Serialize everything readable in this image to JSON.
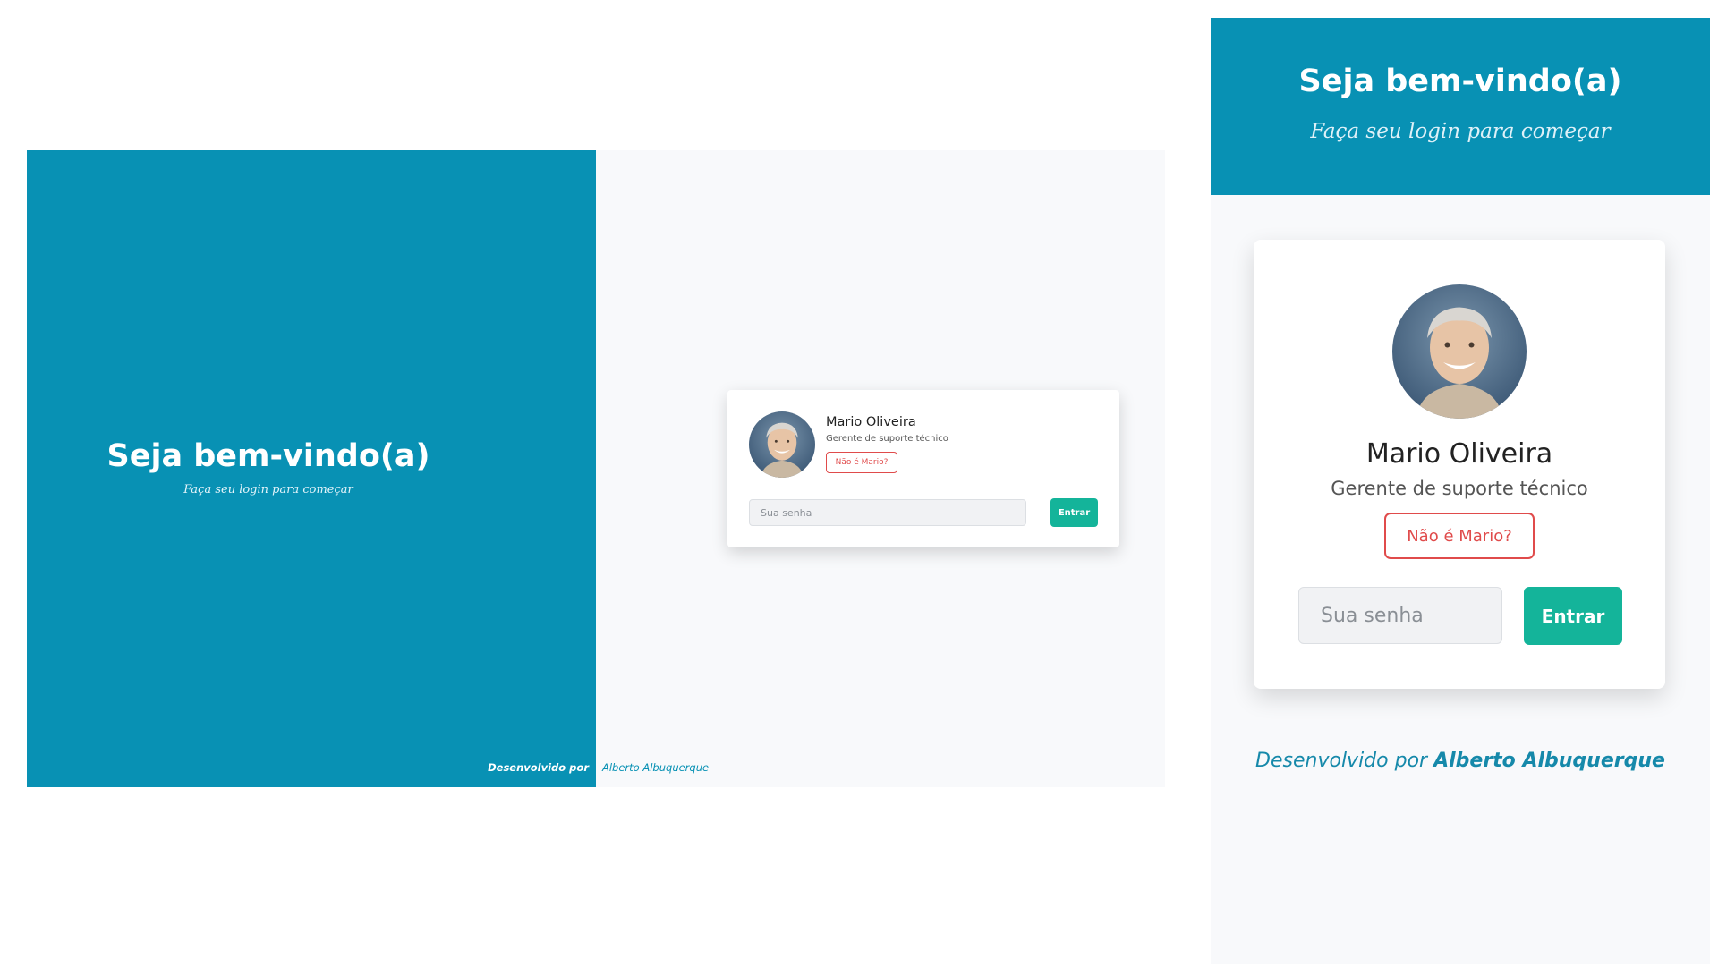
{
  "welcome": {
    "title": "Seja bem-vindo(a)",
    "subtitle": "Faça seu login para começar"
  },
  "user": {
    "name": "Mario Oliveira",
    "role": "Gerente de suporte técnico",
    "not_me_label": "Não é Mario?",
    "avatar_icon": "user-photo-avatar"
  },
  "login": {
    "password_placeholder": "Sua senha",
    "submit_label": "Entrar"
  },
  "footer": {
    "prefix": "Desenvolvido por",
    "author": "Alberto Albuquerque"
  },
  "colors": {
    "primary": "#0891b4",
    "accent": "#14b49a",
    "danger": "#e04b4b",
    "background": "#f8f9fb"
  }
}
